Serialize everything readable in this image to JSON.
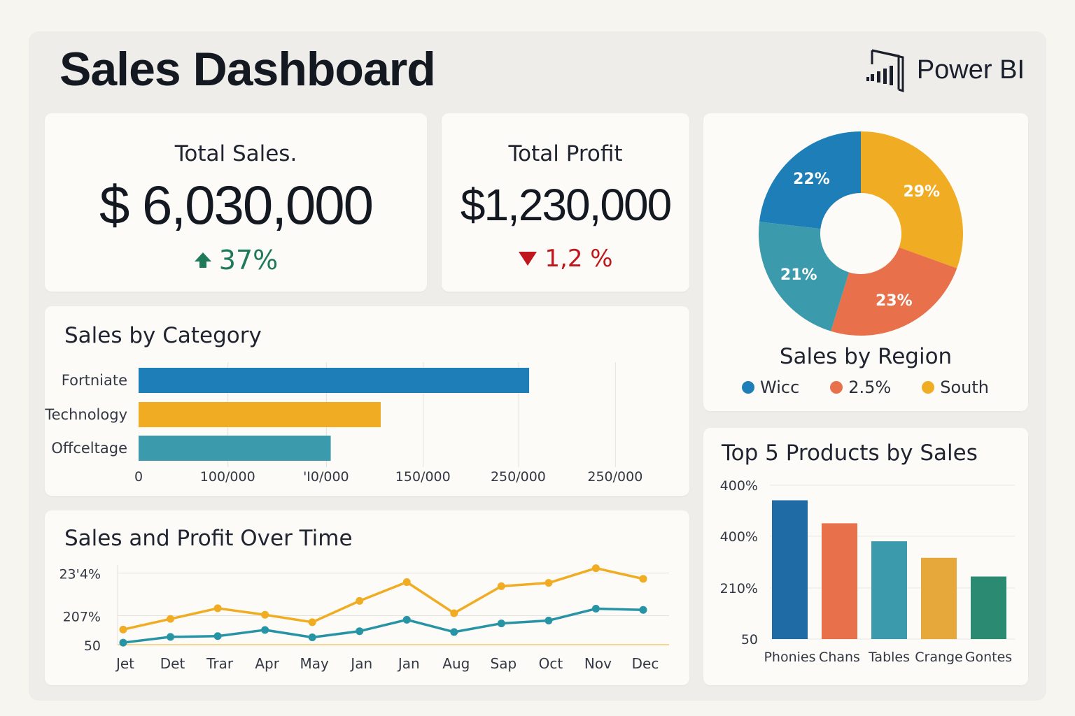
{
  "header": {
    "title": "Sales Dashboard",
    "brand": "Power BI"
  },
  "kpis": {
    "sales": {
      "label": "Total Sales.",
      "value": "$ 6,030,000",
      "delta": "37%",
      "direction": "up",
      "color": "#1f7a5a"
    },
    "profit": {
      "label": "Total Profit",
      "value": "$1,230,000",
      "delta": "1,2 %",
      "direction": "down",
      "color": "#c0171d"
    }
  },
  "colors": {
    "blue": "#1e7fb8",
    "yellow": "#f0ac22",
    "orange": "#e8704a",
    "teal": "#3b9aab",
    "green": "#2a8a72",
    "darkblue": "#1f6ba6",
    "mustard": "#e6a83a"
  },
  "chart_data": [
    {
      "type": "pie",
      "title": "Sales by Region",
      "slices": [
        {
          "label": "22%",
          "value": 22,
          "color": "#1e7fb8"
        },
        {
          "label": "29%",
          "value": 29,
          "color": "#f0ac22"
        },
        {
          "label": "23%",
          "value": 23,
          "color": "#e8704a"
        },
        {
          "label": "21%",
          "value": 21,
          "color": "#3b9aab"
        }
      ],
      "legend": [
        {
          "label": "Wicc",
          "color": "#1e7fb8"
        },
        {
          "label": "2.5%",
          "color": "#e8704a"
        },
        {
          "label": "South",
          "color": "#f0ac22"
        }
      ]
    },
    {
      "type": "bar",
      "orientation": "horizontal",
      "title": "Sales by Category",
      "categories": [
        "Fortniate",
        "Technology",
        "Offceltage"
      ],
      "values": [
        250000,
        155000,
        123000
      ],
      "colors": [
        "#1e7fb8",
        "#f0ac22",
        "#3b9aab"
      ],
      "xlim": [
        0,
        310000
      ],
      "tick_values": [
        0,
        57000,
        120000,
        182000,
        243000,
        305000
      ],
      "tick_labels": [
        "0",
        "100/000",
        "'I0/000",
        "150/000",
        "250/000",
        "250/000"
      ],
      "grid": true
    },
    {
      "type": "line",
      "title": "Sales and Profit Over Time",
      "categories": [
        "Jet",
        "Det",
        "Trar",
        "Apr",
        "May",
        "Jan",
        "Jan",
        "Aug",
        "Sap",
        "Oct",
        "Nov",
        "Dec"
      ],
      "series": [
        {
          "values": [
            62,
            88,
            114,
            98,
            80,
            132,
            178,
            102,
            168,
            176,
            212,
            186
          ],
          "color": "#f0ac22"
        },
        {
          "values": [
            30,
            44,
            46,
            61,
            43,
            58,
            86,
            56,
            77,
            84,
            113,
            110
          ],
          "color": "#2794a5"
        }
      ],
      "ylim": [
        25,
        225
      ],
      "tick_values": [
        25,
        96,
        200
      ],
      "tick_labels": [
        "50",
        "207%",
        "23'4%"
      ],
      "grid": true
    },
    {
      "type": "bar",
      "title": "Top 5 Products by Sales",
      "categories": [
        "Phonies",
        "Chans",
        "Tables",
        "Crange",
        "Gontes"
      ],
      "values": [
        386,
        322,
        272,
        226,
        174
      ],
      "colors": [
        "#1f6ba6",
        "#e8704a",
        "#3b9aab",
        "#e6a83a",
        "#2a8a72"
      ],
      "ylim": [
        0,
        420
      ],
      "tick_values": [
        0,
        142,
        286,
        428
      ],
      "tick_labels": [
        "50",
        "210%",
        "400%",
        "400%"
      ],
      "grid": true
    }
  ]
}
